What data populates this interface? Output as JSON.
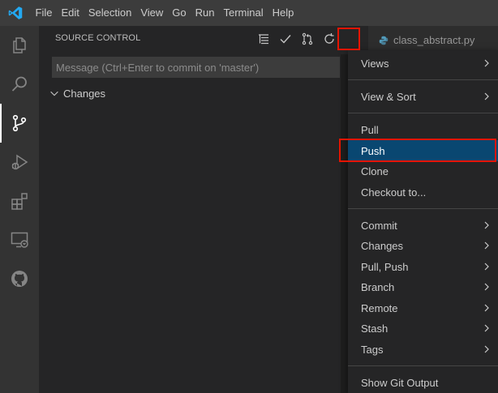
{
  "menu": [
    "File",
    "Edit",
    "Selection",
    "View",
    "Go",
    "Run",
    "Terminal",
    "Help"
  ],
  "sidebar": {
    "title": "SOURCE CONTROL",
    "message_placeholder": "Message (Ctrl+Enter to commit on 'master')",
    "changes_label": "Changes"
  },
  "tab": {
    "label": "class_abstract.py"
  },
  "dropdown": {
    "items": [
      {
        "label": "Views",
        "submenu": true
      },
      {
        "label": "View & Sort",
        "submenu": true
      },
      {
        "label": "Pull",
        "submenu": false
      },
      {
        "label": "Push",
        "submenu": false,
        "selected": true
      },
      {
        "label": "Clone",
        "submenu": false
      },
      {
        "label": "Checkout to...",
        "submenu": false
      },
      {
        "label": "Commit",
        "submenu": true
      },
      {
        "label": "Changes",
        "submenu": true
      },
      {
        "label": "Pull, Push",
        "submenu": true
      },
      {
        "label": "Branch",
        "submenu": true
      },
      {
        "label": "Remote",
        "submenu": true
      },
      {
        "label": "Stash",
        "submenu": true
      },
      {
        "label": "Tags",
        "submenu": true
      },
      {
        "label": "Show Git Output",
        "submenu": false
      }
    ]
  },
  "colors": {
    "highlight_box": "#e51400",
    "selected_bg": "#094771",
    "vscode_blue": "#23a9f2"
  }
}
